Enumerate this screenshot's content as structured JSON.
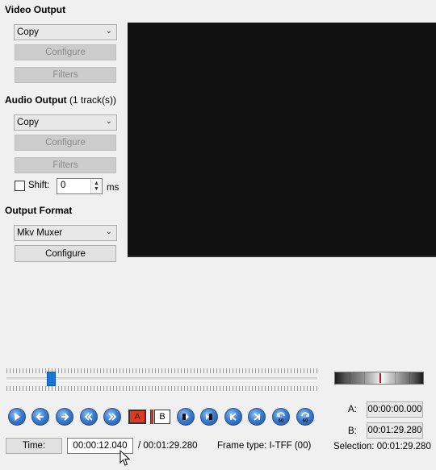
{
  "video_output": {
    "title": "Video Output",
    "codec_selected": "Copy",
    "configure_label": "Configure",
    "filters_label": "Filters"
  },
  "audio_output": {
    "title": "Audio Output",
    "track_info": "(1 track(s))",
    "codec_selected": "Copy",
    "configure_label": "Configure",
    "filters_label": "Filters",
    "shift_label": "Shift:",
    "shift_checked": false,
    "shift_value": "0",
    "shift_unit": "ms"
  },
  "output_format": {
    "title": "Output Format",
    "muxer_selected": "Mkv Muxer",
    "configure_label": "Configure"
  },
  "timeline": {
    "position_fraction": 0.135,
    "jog_center": 0.5
  },
  "controls": {
    "buttons": [
      {
        "name": "play-button",
        "icon": "play-icon"
      },
      {
        "name": "previous-frame-button",
        "icon": "arrow-left-icon"
      },
      {
        "name": "next-frame-button",
        "icon": "arrow-right-icon"
      },
      {
        "name": "previous-keyframe-button",
        "icon": "rewind-icon"
      },
      {
        "name": "next-keyframe-button",
        "icon": "fast-forward-icon"
      }
    ],
    "marker_a_label": "A",
    "marker_b_label": "B",
    "nav_buttons": [
      {
        "name": "goto-marker-a-button",
        "icon": "goto-marker-a-icon"
      },
      {
        "name": "goto-marker-b-button",
        "icon": "goto-marker-b-icon"
      },
      {
        "name": "goto-start-button",
        "icon": "skip-start-icon"
      },
      {
        "name": "goto-end-button",
        "icon": "skip-end-icon"
      },
      {
        "name": "back-one-minute-button",
        "icon": "back-60-icon",
        "text": "60"
      },
      {
        "name": "forward-one-minute-button",
        "icon": "forward-60-icon",
        "text": "60"
      }
    ]
  },
  "selection": {
    "a_label": "A:",
    "a_value": "00:00:00.000",
    "b_label": "B:",
    "b_value": "00:01:29.280",
    "selection_label": "Selection: 00:01:29.280"
  },
  "status": {
    "time_button_label": "Time:",
    "current_time": "00:00:12.040",
    "total_time": "/ 00:01:29.280",
    "frame_type": "Frame type:  I-TFF (00)"
  }
}
